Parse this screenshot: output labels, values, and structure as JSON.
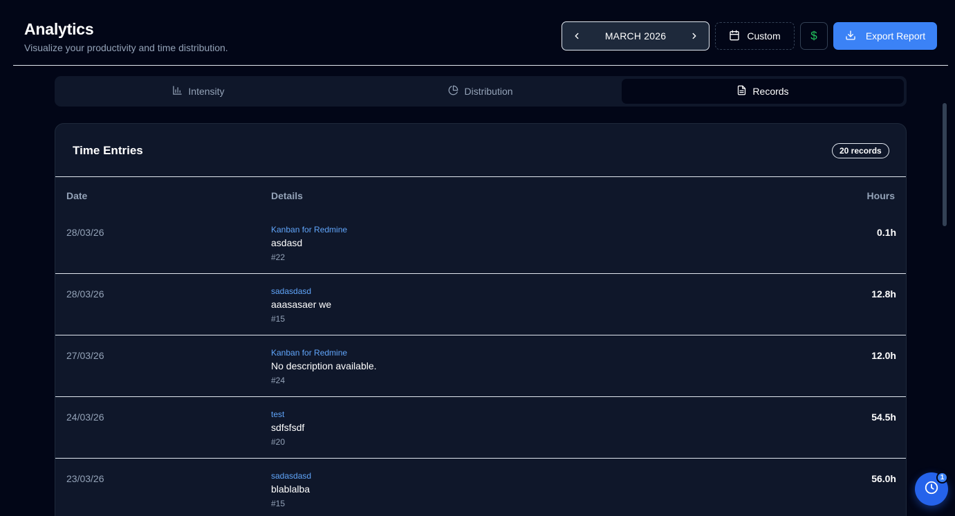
{
  "header": {
    "title": "Analytics",
    "subtitle": "Visualize your productivity and time distribution.",
    "month": "MARCH 2026",
    "custom_label": "Custom",
    "currency_symbol": "$",
    "export_label": "Export Report"
  },
  "tabs": [
    {
      "label": "Intensity",
      "icon": "bar-chart-icon",
      "active": false
    },
    {
      "label": "Distribution",
      "icon": "pie-chart-icon",
      "active": false
    },
    {
      "label": "Records",
      "icon": "file-text-icon",
      "active": true
    }
  ],
  "card": {
    "title": "Time Entries",
    "badge": "20 records",
    "columns": {
      "date": "Date",
      "details": "Details",
      "hours": "Hours"
    }
  },
  "rows": [
    {
      "date": "28/03/26",
      "project": "Kanban for Redmine",
      "description": "asdasd",
      "issue": "#22",
      "hours": "0.1h"
    },
    {
      "date": "28/03/26",
      "project": "sadasdasd",
      "description": "aaasasaer we",
      "issue": "#15",
      "hours": "12.8h"
    },
    {
      "date": "27/03/26",
      "project": "Kanban for Redmine",
      "description": "No description available.",
      "issue": "#24",
      "hours": "12.0h"
    },
    {
      "date": "24/03/26",
      "project": "test",
      "description": "sdfsfsdf",
      "issue": "#20",
      "hours": "54.5h"
    },
    {
      "date": "23/03/26",
      "project": "sadasdasd",
      "description": "blablalba",
      "issue": "#15",
      "hours": "56.0h"
    }
  ],
  "fab": {
    "badge": "1",
    "icon": "clock-icon"
  },
  "colors": {
    "background": "#020617",
    "surface": "#0f172a",
    "accent": "#3b82f6",
    "link": "#60a5fa",
    "currency": "#22c55e"
  }
}
